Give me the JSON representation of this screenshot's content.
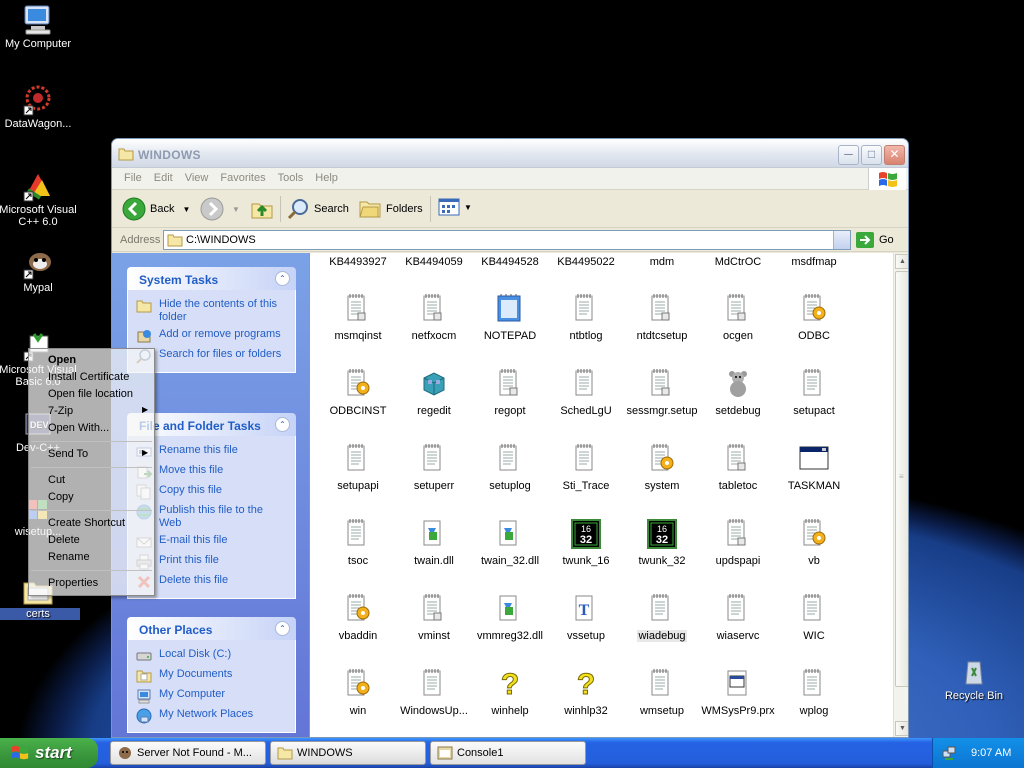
{
  "desktop": {
    "icons": [
      {
        "label": "My Computer"
      },
      {
        "label": "DataWagon..."
      },
      {
        "label": "Microsoft Visual C++ 6.0"
      },
      {
        "label": "Mypal"
      },
      {
        "label": "Microsoft Visual Basic 6.0"
      },
      {
        "label": "Dev-C++"
      },
      {
        "label": "wisetup..."
      },
      {
        "label": "certs"
      },
      {
        "label": "Recycle Bin"
      }
    ]
  },
  "window": {
    "title": "WINDOWS",
    "menu": [
      "File",
      "Edit",
      "View",
      "Favorites",
      "Tools",
      "Help"
    ],
    "toolbar": {
      "back": "Back",
      "search": "Search",
      "folders": "Folders"
    },
    "address": {
      "label": "Address",
      "value": "C:\\WINDOWS",
      "go": "Go"
    }
  },
  "taskpane": {
    "system_tasks": {
      "title": "System Tasks",
      "items": [
        "Hide the contents of this folder",
        "Add or remove programs",
        "Search for files or folders"
      ]
    },
    "file_tasks": {
      "title": "File and Folder Tasks",
      "items": [
        "Rename this file",
        "Move this file",
        "Copy this file",
        "Publish this file to the Web",
        "E-mail this file",
        "Print this file",
        "Delete this file"
      ]
    },
    "other_places": {
      "title": "Other Places",
      "items": [
        "Local Disk (C:)",
        "My Documents",
        "My Computer",
        "My Network Places"
      ]
    }
  },
  "files": {
    "top_row": [
      "KB4493927",
      "KB4494059",
      "KB4494528",
      "KB4495022",
      "mdm",
      "MdCtrOC",
      "msdfmap"
    ],
    "items": [
      {
        "name": "msmqinst",
        "icon": "ini"
      },
      {
        "name": "netfxocm",
        "icon": "ini"
      },
      {
        "name": "NOTEPAD",
        "icon": "notepad"
      },
      {
        "name": "ntbtlog",
        "icon": "txt"
      },
      {
        "name": "ntdtcsetup",
        "icon": "ini"
      },
      {
        "name": "ocgen",
        "icon": "ini"
      },
      {
        "name": "ODBC",
        "icon": "cfg"
      },
      {
        "name": "ODBCINST",
        "icon": "cfg"
      },
      {
        "name": "regedit",
        "icon": "regedit"
      },
      {
        "name": "regopt",
        "icon": "ini"
      },
      {
        "name": "SchedLgU",
        "icon": "txt"
      },
      {
        "name": "sessmgr.setup",
        "icon": "ini"
      },
      {
        "name": "setdebug",
        "icon": "bear"
      },
      {
        "name": "setupact",
        "icon": "txt"
      },
      {
        "name": "setupapi",
        "icon": "txt"
      },
      {
        "name": "setuperr",
        "icon": "txt"
      },
      {
        "name": "setuplog",
        "icon": "txt"
      },
      {
        "name": "Sti_Trace",
        "icon": "txt"
      },
      {
        "name": "system",
        "icon": "cfg"
      },
      {
        "name": "tabletoc",
        "icon": "ini"
      },
      {
        "name": "TASKMAN",
        "icon": "window"
      },
      {
        "name": "tsoc",
        "icon": "txt"
      },
      {
        "name": "twain.dll",
        "icon": "dll"
      },
      {
        "name": "twain_32.dll",
        "icon": "dll"
      },
      {
        "name": "twunk_16",
        "icon": "chip"
      },
      {
        "name": "twunk_32",
        "icon": "chip"
      },
      {
        "name": "updspapi",
        "icon": "ini"
      },
      {
        "name": "vb",
        "icon": "cfg"
      },
      {
        "name": "vbaddin",
        "icon": "cfg"
      },
      {
        "name": "vminst",
        "icon": "ini"
      },
      {
        "name": "vmmreg32.dll",
        "icon": "dll"
      },
      {
        "name": "vssetup",
        "icon": "font"
      },
      {
        "name": "wiadebug",
        "icon": "txt",
        "selected": true
      },
      {
        "name": "wiaservc",
        "icon": "txt"
      },
      {
        "name": "WIC",
        "icon": "txt"
      },
      {
        "name": "win",
        "icon": "cfg"
      },
      {
        "name": "WindowsUp...",
        "icon": "txt"
      },
      {
        "name": "winhelp",
        "icon": "help"
      },
      {
        "name": "winhlp32",
        "icon": "help"
      },
      {
        "name": "wmsetup",
        "icon": "txt"
      },
      {
        "name": "WMSysPr9.prx",
        "icon": "prx"
      },
      {
        "name": "wplog",
        "icon": "txt"
      }
    ]
  },
  "context_menu": {
    "items": [
      "Open",
      "Install Certificate",
      "Open file location",
      "7-Zip",
      "Open With...",
      "Send To",
      "Cut",
      "Copy",
      "Create Shortcut",
      "Delete",
      "Rename",
      "Properties"
    ]
  },
  "taskbar": {
    "start": "start",
    "tasks": [
      "Server Not Found - M...",
      "WINDOWS",
      "Console1"
    ],
    "clock": "9:07 AM"
  }
}
